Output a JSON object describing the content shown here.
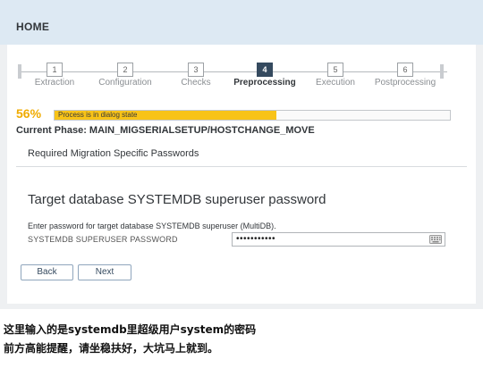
{
  "header": {
    "title": "HOME"
  },
  "steps": [
    {
      "num": "1",
      "label": "Extraction"
    },
    {
      "num": "2",
      "label": "Configuration"
    },
    {
      "num": "3",
      "label": "Checks"
    },
    {
      "num": "4",
      "label": "Preprocessing",
      "active": true
    },
    {
      "num": "5",
      "label": "Execution"
    },
    {
      "num": "6",
      "label": "Postprocessing"
    }
  ],
  "progress": {
    "percent_label": "56%",
    "fraction": 0.56,
    "status_text": "Process is in dialog state",
    "fill_color": "#f8c318",
    "percent_color": "#f0ab00"
  },
  "phase": "Current Phase: MAIN_MIGSERIALSETUP/HOSTCHANGE_MOVE",
  "section_title": "Required Migration Specific Passwords",
  "form": {
    "title": "Target database SYSTEMDB superuser password",
    "hint": "Enter password for target database SYSTEMDB superuser (MultiDB).",
    "field_label": "SYSTEMDB SUPERUSER PASSWORD",
    "field_value": "•••••••••••"
  },
  "buttons": {
    "back": "Back",
    "next": "Next"
  },
  "captions": [
    "这里输入的是systemdb里超级用户system的密码",
    "前方高能提醒，请坐稳扶好，大坑马上就到。"
  ],
  "icons": {
    "keyboard": "keyboard-icon"
  }
}
